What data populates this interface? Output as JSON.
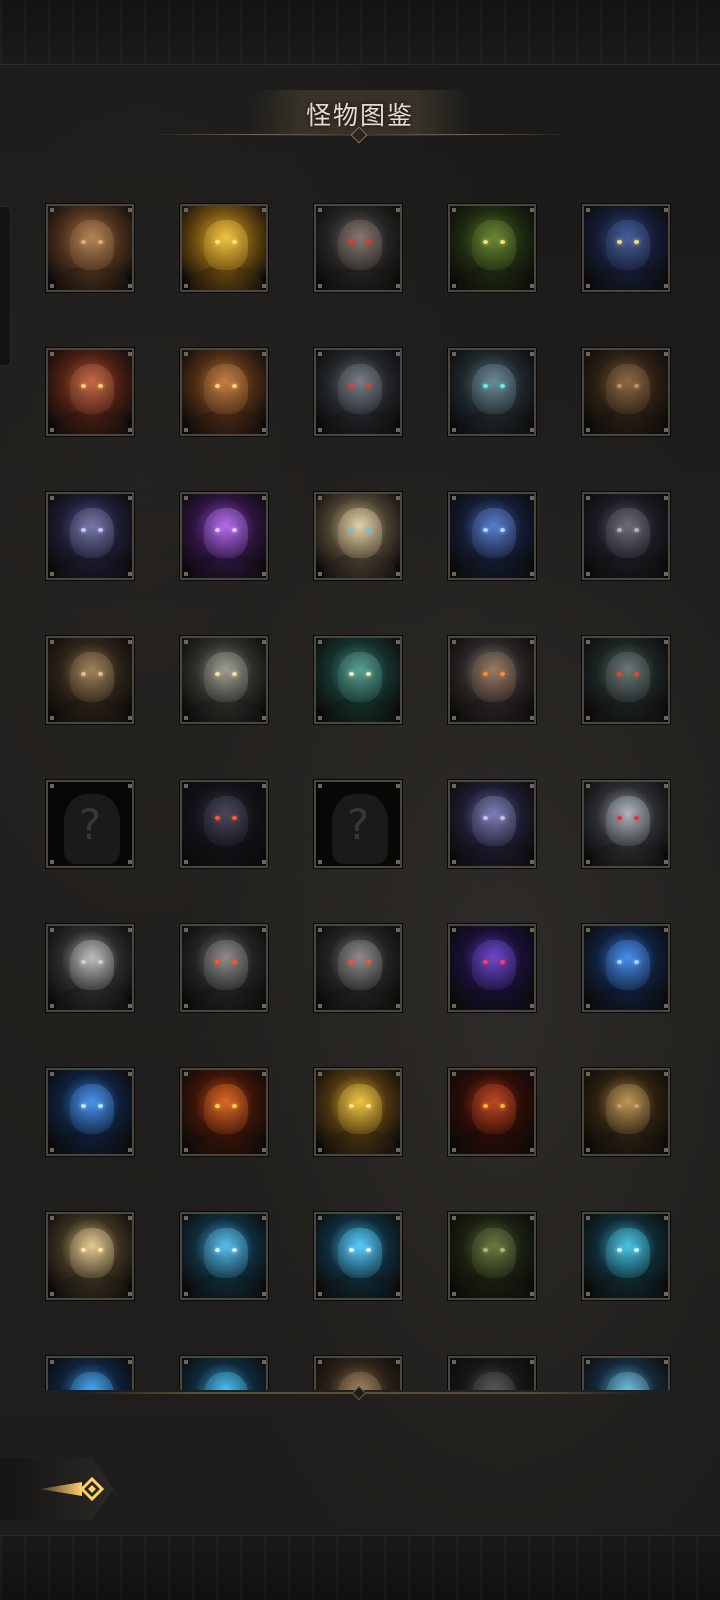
{
  "header": {
    "title": "怪物图鉴"
  },
  "grid": {
    "rows": [
      [
        {
          "name": "monster-goblin-elder",
          "c1": "#a0744a",
          "c2": "#4a2f1c",
          "c3": "#b38557",
          "eye": "#d9b070"
        },
        {
          "name": "monster-golden-dragon",
          "c1": "#e2b030",
          "c2": "#6b4a10",
          "c3": "#f0c640",
          "eye": "#ffdf7a"
        },
        {
          "name": "monster-masked-bandit",
          "c1": "#6d6a66",
          "c2": "#262422",
          "c3": "#8a7a72",
          "eye": "#e03a2a"
        },
        {
          "name": "monster-green-hooded-cultist",
          "c1": "#5b7a2a",
          "c2": "#1f2a10",
          "c3": "#6b8a33",
          "eye": "#f2e07a"
        },
        {
          "name": "monster-blue-hooded-cultist",
          "c1": "#394e8a",
          "c2": "#151c33",
          "c3": "#47609e",
          "eye": "#f2e07a"
        }
      ],
      [
        {
          "name": "monster-cyclops-ogre-red",
          "c1": "#b0563a",
          "c2": "#4a1f14",
          "c3": "#c46a48",
          "eye": "#ffd070"
        },
        {
          "name": "monster-cyclops-ogre-orange",
          "c1": "#b0703a",
          "c2": "#4a2a14",
          "c3": "#c47f48",
          "eye": "#ffd070"
        },
        {
          "name": "monster-armored-sentinel-red",
          "c1": "#6a6e73",
          "c2": "#22252a",
          "c3": "#7a8088",
          "eye": "#e0402a"
        },
        {
          "name": "monster-armored-sentinel-cyan",
          "c1": "#5d7480",
          "c2": "#1e272c",
          "c3": "#6f8c98",
          "eye": "#5ff0e8"
        },
        {
          "name": "monster-barrel-brute",
          "c1": "#7a5a3a",
          "c2": "#2c1f14",
          "c3": "#8c6a44",
          "eye": "#c09060"
        }
      ],
      [
        {
          "name": "monster-masked-sorcerer",
          "c1": "#5a5a9a",
          "c2": "#1c1c33",
          "c3": "#7a7aa8",
          "eye": "#c0c8ff"
        },
        {
          "name": "monster-void-orb",
          "c1": "#9a4ad0",
          "c2": "#2c1540",
          "c3": "#b870f0",
          "eye": "#e8c0ff"
        },
        {
          "name": "monster-elf-priestess",
          "c1": "#d0c090",
          "c2": "#4a4030",
          "c3": "#e6d4a8",
          "eye": "#70c0e0"
        },
        {
          "name": "monster-spectral-wraith",
          "c1": "#4a6ab0",
          "c2": "#141c33",
          "c3": "#5a80d0",
          "eye": "#a8d8ff"
        },
        {
          "name": "monster-dark-elf-assassin",
          "c1": "#5a5a66",
          "c2": "#1a1a22",
          "c3": "#6e6e7a",
          "eye": "#b0b0c0"
        }
      ],
      [
        {
          "name": "monster-horned-shaman",
          "c1": "#8a7050",
          "c2": "#2c2218",
          "c3": "#a0845e",
          "eye": "#e0c080"
        },
        {
          "name": "monster-pale-orc",
          "c1": "#8a8a80",
          "c2": "#2c2c28",
          "c3": "#a0a094",
          "eye": "#f0e0a0"
        },
        {
          "name": "monster-teal-troll",
          "c1": "#4a8a80",
          "c2": "#15302c",
          "c3": "#5aa094",
          "eye": "#e0f0c0"
        },
        {
          "name": "monster-grey-haired-warlord",
          "c1": "#8a8a8a",
          "c2": "#2a2424",
          "c3": "#9a7a60",
          "eye": "#ff8a30"
        },
        {
          "name": "monster-werewolf",
          "c1": "#5a6a6a",
          "c2": "#1c2222",
          "c3": "#6a7a7a",
          "eye": "#e04a2a"
        }
      ],
      [
        {
          "name": "monster-unknown-1",
          "unknown": true,
          "label": "?"
        },
        {
          "name": "monster-shadow-beast",
          "c1": "#3a3a4a",
          "c2": "#121218",
          "c3": "#4a4a5c",
          "eye": "#ff5a2a"
        },
        {
          "name": "monster-unknown-2",
          "unknown": true,
          "label": "?"
        },
        {
          "name": "monster-violet-alien",
          "c1": "#6a6aa0",
          "c2": "#1c1c30",
          "c3": "#8080b8",
          "eye": "#c0c0e8"
        },
        {
          "name": "monster-silver-haired-witch",
          "c1": "#9aa0a8",
          "c2": "#2a2c30",
          "c3": "#b0b8c0",
          "eye": "#e03030"
        }
      ],
      [
        {
          "name": "monster-silver-elf-maiden",
          "c1": "#a8a8a8",
          "c2": "#2a2a2a",
          "c3": "#c0c0c0",
          "eye": "#d0d0d0"
        },
        {
          "name": "monster-stone-gargoyle-1",
          "c1": "#7a7a7a",
          "c2": "#222222",
          "c3": "#909090",
          "eye": "#ff5030"
        },
        {
          "name": "monster-stone-gargoyle-2",
          "c1": "#7a7a7a",
          "c2": "#222222",
          "c3": "#909090",
          "eye": "#ff5030"
        },
        {
          "name": "monster-purple-tentacle-horror",
          "c1": "#5a3ab0",
          "c2": "#180f33",
          "c3": "#6e4ad0",
          "eye": "#ff3a6a"
        },
        {
          "name": "monster-blue-armored-knight",
          "c1": "#3a7ad0",
          "c2": "#0f1f3a",
          "c3": "#4a90f0",
          "eye": "#a0d8ff"
        }
      ],
      [
        {
          "name": "monster-blue-crowned-king",
          "c1": "#3a80d8",
          "c2": "#0f1f3a",
          "c3": "#4a96f0",
          "eye": "#c0e8ff"
        },
        {
          "name": "monster-fire-dragon",
          "c1": "#c8541a",
          "c2": "#3a1408",
          "c3": "#e06a24",
          "eye": "#ffd050"
        },
        {
          "name": "monster-golden-haired-warrior",
          "c1": "#e0b030",
          "c2": "#4a3410",
          "c3": "#f0c844",
          "eye": "#ffe080"
        },
        {
          "name": "monster-horned-fire-demon",
          "c1": "#a83a1a",
          "c2": "#2c0c06",
          "c3": "#c04a24",
          "eye": "#ffb030"
        },
        {
          "name": "monster-straw-hat-ronin",
          "c1": "#a8824a",
          "c2": "#2c2010",
          "c3": "#c09858",
          "eye": "#c0a070"
        }
      ],
      [
        {
          "name": "monster-blond-swordsman",
          "c1": "#d0b880",
          "c2": "#3a3020",
          "c3": "#e6cc94",
          "eye": "#ffe6a0"
        },
        {
          "name": "monster-ice-dwarf",
          "c1": "#4aa8d8",
          "c2": "#0f2c3a",
          "c3": "#5ac0f0",
          "eye": "#d0f0ff"
        },
        {
          "name": "monster-ice-demon",
          "c1": "#4ab8e8",
          "c2": "#0f2c3a",
          "c3": "#5ad0ff",
          "eye": "#e0f8ff"
        },
        {
          "name": "monster-mossy-golem",
          "c1": "#5a6a3a",
          "c2": "#1a2010",
          "c3": "#6a7a44",
          "eye": "#a0c070"
        },
        {
          "name": "monster-frost-behemoth",
          "c1": "#3ab0d0",
          "c2": "#0f2a33",
          "c3": "#4ac8e8",
          "eye": "#d0f8ff"
        }
      ],
      [
        {
          "name": "monster-blue-spirit",
          "c1": "#3a90d8",
          "c2": "#0f203a",
          "c3": "#4aa8f0",
          "eye": "#d0ecff"
        },
        {
          "name": "monster-azure-siren",
          "c1": "#3aa8d8",
          "c2": "#0f283a",
          "c3": "#4ac0f0",
          "eye": "#d0f4ff"
        },
        {
          "name": "monster-bear-warrior",
          "c1": "#8a7050",
          "c2": "#2c2218",
          "c3": "#a08460",
          "eye": "#d0a870"
        },
        {
          "name": "monster-dark-rogue",
          "c1": "#4a4a4a",
          "c2": "#161616",
          "c3": "#5a5a5a",
          "eye": "#a0a0a0"
        },
        {
          "name": "monster-crystal-giant",
          "c1": "#5aa8c8",
          "c2": "#15283a",
          "c3": "#70c0e0",
          "eye": "#e0f8ff"
        }
      ]
    ]
  },
  "footer": {
    "back_icon": "back-arrow-icon"
  }
}
